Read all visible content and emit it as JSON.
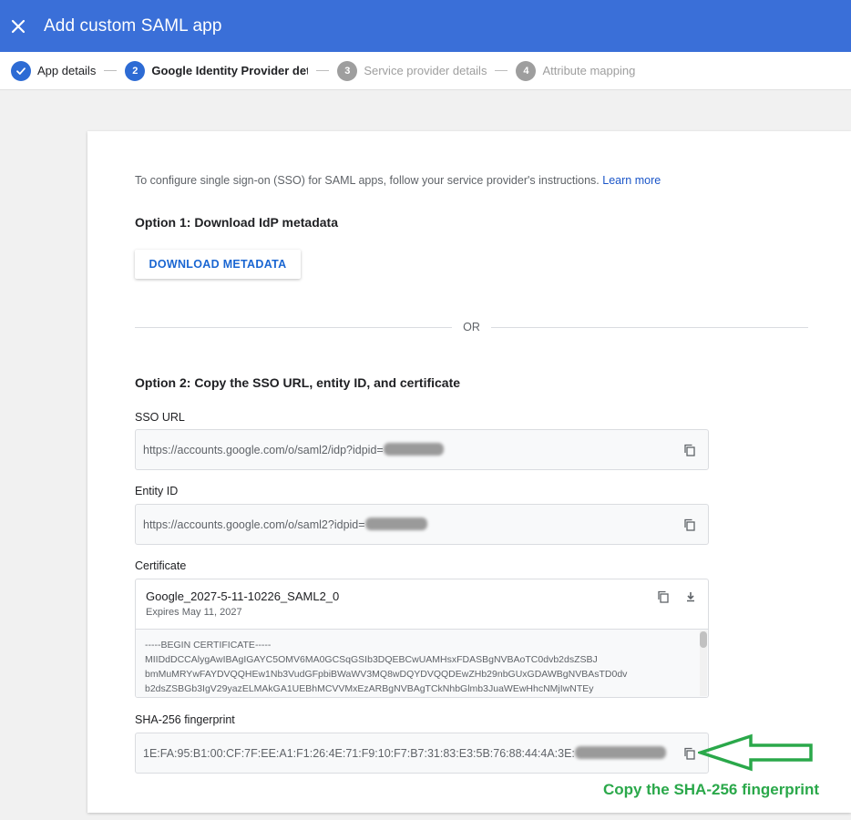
{
  "header": {
    "title": "Add custom SAML app"
  },
  "stepper": {
    "steps": [
      {
        "num": "",
        "label": "App details",
        "state": "done"
      },
      {
        "num": "2",
        "label": "Google Identity Provider details",
        "state": "active"
      },
      {
        "num": "3",
        "label": "Service provider details",
        "state": "pending"
      },
      {
        "num": "4",
        "label": "Attribute mapping",
        "state": "pending"
      }
    ]
  },
  "content": {
    "intro": "To configure single sign-on (SSO) for SAML apps, follow your service provider's instructions.",
    "learn_more": "Learn more",
    "option1_title": "Option 1: Download IdP metadata",
    "download_button": "DOWNLOAD METADATA",
    "or_label": "OR",
    "option2_title": "Option 2: Copy the SSO URL, entity ID, and certificate",
    "sso_url_label": "SSO URL",
    "sso_url_value": "https://accounts.google.com/o/saml2/idp?idpid=",
    "entity_id_label": "Entity ID",
    "entity_id_value": "https://accounts.google.com/o/saml2?idpid=",
    "certificate_label": "Certificate",
    "certificate": {
      "name": "Google_2027-5-11-10226_SAML2_0",
      "expires": "Expires May 11, 2027",
      "lines": [
        "-----BEGIN CERTIFICATE-----",
        "MIIDdDCCAlygAwIBAgIGAYC5OMV6MA0GCSqGSIb3DQEBCwUAMHsxFDASBgNVBAoTC0dvb2dsZSBJ",
        "bmMuMRYwFAYDVQQHEw1Nb3VudGFpbiBWaWV3MQ8wDQYDVQQDEwZHb29nbGUxGDAWBgNVBAsTD0dv",
        "b2dsZSBGb3IgV29yazELMAkGA1UEBhMCVVMxEzARBgNVBAgTCkNhbGlmb3JuaWEwHhcNMjIwNTEy"
      ]
    },
    "sha_label": "SHA-256 fingerprint",
    "sha_value": "1E:FA:95:B1:00:CF:7F:EE:A1:F1:26:4E:71:F9:10:F7:B7:31:83:E3:5B:76:88:44:4A:3E:"
  },
  "annotation": {
    "text": "Copy the SHA-256 fingerprint",
    "color": "#2aa84a"
  },
  "colors": {
    "header": "#3a6fd8",
    "accent": "#2d6bd4",
    "link": "#1a55c8"
  },
  "icons": {
    "close": "close-icon",
    "check": "check-icon",
    "copy": "copy-icon",
    "download": "download-icon"
  }
}
